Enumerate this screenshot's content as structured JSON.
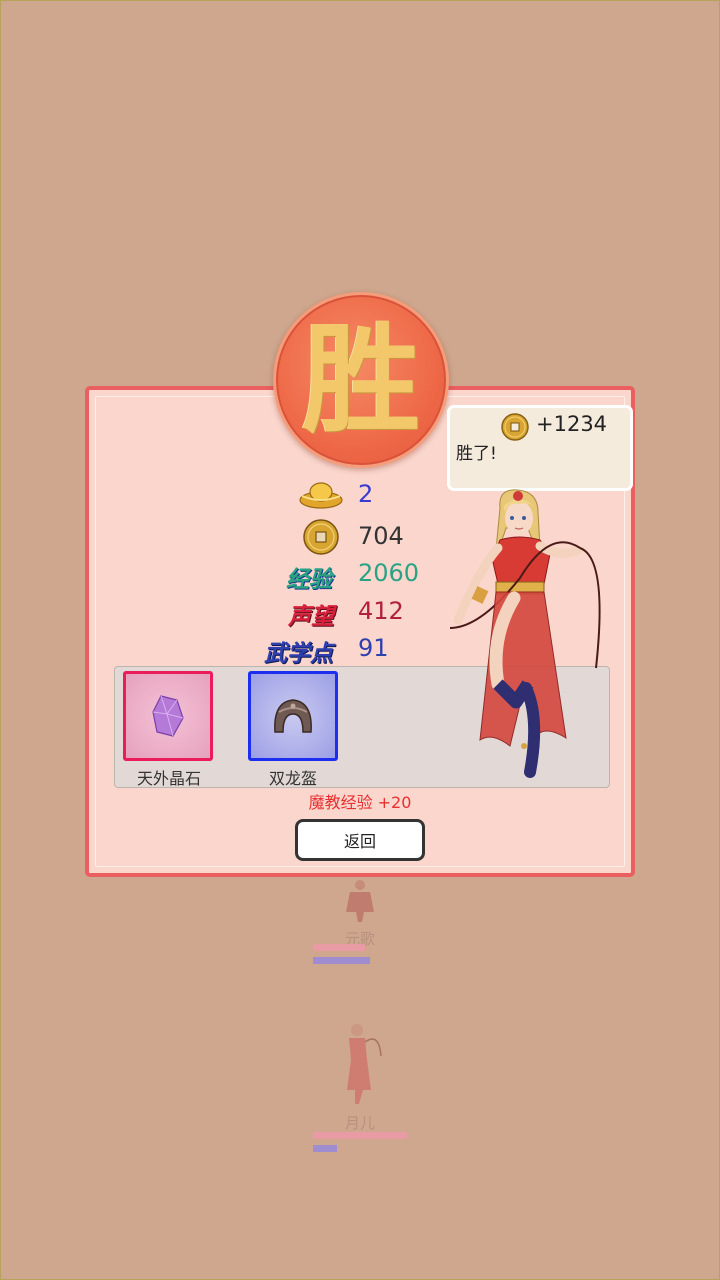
{
  "result": {
    "title_glyph": "胜",
    "bubble": {
      "reward": "+1234",
      "text": "胜了!"
    },
    "stats": {
      "gold_ingot": "2",
      "coins": "704",
      "exp_label": "经验",
      "exp_value": "2060",
      "fame_label": "声望",
      "fame_value": "412",
      "martial_label": "武学点",
      "martial_value": "91"
    },
    "loot": [
      {
        "name": "天外晶石",
        "icon": "crystal-icon"
      },
      {
        "name": "双龙盔",
        "icon": "helmet-icon"
      }
    ],
    "sect_exp": "魔教经验 +20",
    "back_label": "返回"
  },
  "battlefield": {
    "units": [
      {
        "name": "元歌",
        "hp": 0.55,
        "mp": 0.6
      },
      {
        "name": "月儿",
        "hp": 1.0,
        "mp": 0.25
      }
    ]
  },
  "colors": {
    "background": "#cea78e",
    "dialog_border": "#ea5f5f",
    "exp": "#2aa385",
    "fame": "#b0203a",
    "martial": "#2e3fb0",
    "value_blue": "#3a3ad0"
  }
}
